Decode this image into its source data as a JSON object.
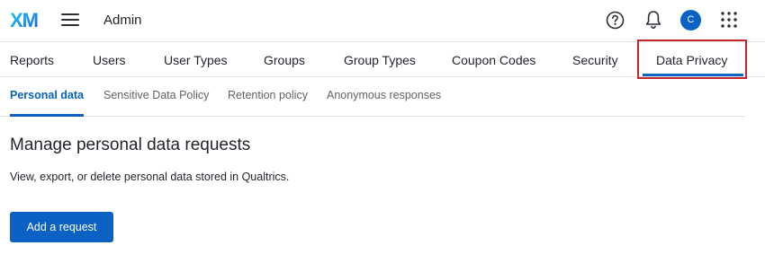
{
  "header": {
    "logo_text": "XM",
    "app_title": "Admin",
    "avatar_initial": "C"
  },
  "main_nav": {
    "items": [
      {
        "label": "Reports"
      },
      {
        "label": "Users"
      },
      {
        "label": "User Types"
      },
      {
        "label": "Groups"
      },
      {
        "label": "Group Types"
      },
      {
        "label": "Coupon Codes"
      },
      {
        "label": "Security"
      },
      {
        "label": "Data Privacy",
        "active": true
      }
    ]
  },
  "sub_nav": {
    "items": [
      {
        "label": "Personal data",
        "active": true
      },
      {
        "label": "Sensitive Data Policy"
      },
      {
        "label": "Retention policy"
      },
      {
        "label": "Anonymous responses"
      }
    ]
  },
  "content": {
    "title": "Manage personal data requests",
    "description": "View, export, or delete personal data stored in Qualtrics.",
    "add_button_label": "Add a request"
  },
  "colors": {
    "accent": "#0b62c4",
    "highlight": "#c4262e"
  },
  "icons": [
    "xm-logo-icon",
    "hamburger-menu-icon",
    "help-icon",
    "bell-icon",
    "apps-grid-icon"
  ]
}
